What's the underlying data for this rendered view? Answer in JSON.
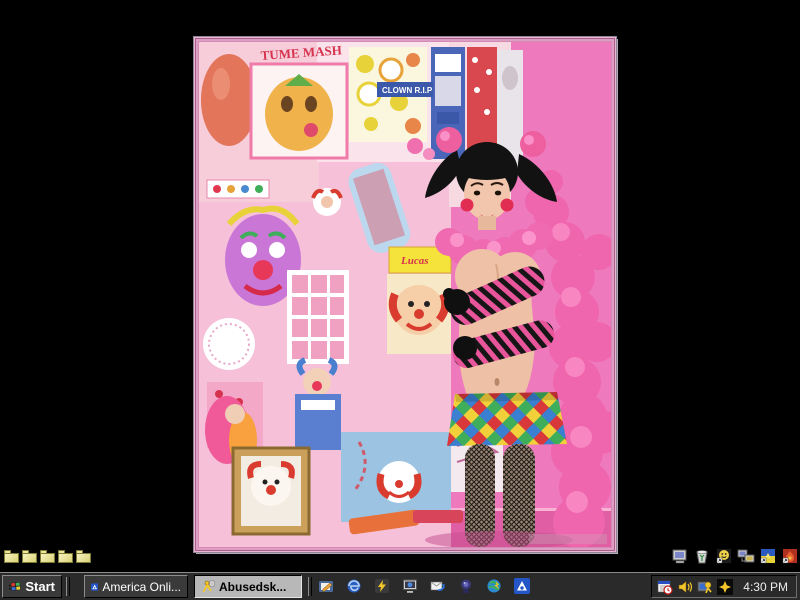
{
  "desktop": {
    "background_color": "#000000",
    "folders": {
      "count": 5,
      "icon": "folder-icon"
    },
    "icons": [
      {
        "name": "my-computer-icon"
      },
      {
        "name": "recycle-bin-icon"
      },
      {
        "name": "smiley-shortcut-icon"
      },
      {
        "name": "network-neighborhood-icon"
      },
      {
        "name": "picture-shortcut-icon"
      },
      {
        "name": "flame-picture-shortcut-icon"
      }
    ]
  },
  "photo": {
    "frame_color": "#d48ab4",
    "wall_color": "#ee7abd",
    "visible_text": {
      "poster_top": "TUME MASH",
      "banner": "CLOWN R.I.P",
      "candy_box": "Lucas"
    }
  },
  "taskbar": {
    "start_label": "Start",
    "buttons": [
      {
        "label": "America Onli...",
        "icon": "aol-icon",
        "active": false
      },
      {
        "label": "Abusedsk...",
        "icon": "aim-running-man-icon",
        "active": true
      }
    ],
    "quick_launch": [
      "show-desktop-icon",
      "internet-explorer-icon",
      "winamp-icon",
      "display-icon",
      "outlook-express-icon",
      "webcam-icon",
      "globe-icon",
      "aol-icon"
    ],
    "tray": {
      "icons": [
        "task-scheduler-icon",
        "volume-icon",
        "display-settings-icon",
        "star-app-icon"
      ],
      "clock": "4:30 PM"
    },
    "colors": {
      "bar": "#2a2a2a",
      "button": "#3a3a3a",
      "active_button": "#b8b8b8"
    }
  }
}
